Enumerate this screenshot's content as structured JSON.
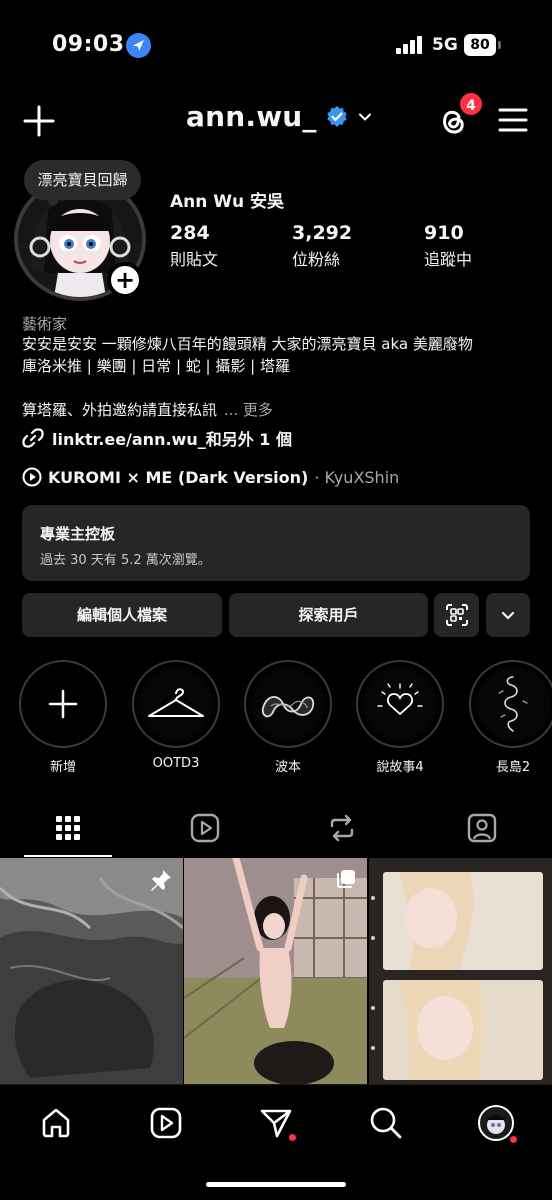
{
  "status_bar": {
    "time": "09:03",
    "network": "5G",
    "battery": "80"
  },
  "header": {
    "username": "ann.wu_",
    "threads_badge": "4"
  },
  "profile": {
    "note": "漂亮寶貝回歸",
    "display_name": "Ann Wu 安吳",
    "stats": [
      {
        "value": "284",
        "label": "則貼文"
      },
      {
        "value": "3,292",
        "label": "位粉絲"
      },
      {
        "value": "910",
        "label": "追蹤中"
      }
    ],
    "category": "藝術家",
    "bio_line1": "安安是安安 一顆修煉八百年的饅頭精 大家的漂亮寶貝 aka 美麗廢物",
    "bio_line2": "庫洛米推 | 樂團 | 日常 | 蛇 | 攝影 | 塔羅",
    "bio_line3": "算塔羅、外拍邀約請直接私訊",
    "bio_more": "... 更多",
    "link": "linktr.ee/ann.wu_和另外 1 個",
    "music_title": "KUROMI × ME (Dark Version)",
    "music_artist": "· KyuXShin"
  },
  "dashboard": {
    "title": "專業主控板",
    "subtitle": "過去 30 天有 5.2 萬次瀏覽。"
  },
  "buttons": {
    "edit_profile": "編輯個人檔案",
    "discover": "探索用戶"
  },
  "highlights": [
    {
      "label": "新增",
      "icon": "plus-icon"
    },
    {
      "label": "OOTD3",
      "icon": "hanger-icon"
    },
    {
      "label": "波本",
      "icon": "snake-coil-icon"
    },
    {
      "label": "說故事4",
      "icon": "heart-sparkle-icon"
    },
    {
      "label": "長島2",
      "icon": "snake-icon"
    }
  ],
  "tabs": [
    {
      "icon": "grid-icon",
      "active": true
    },
    {
      "icon": "reels-icon",
      "active": false
    },
    {
      "icon": "reposts-icon",
      "active": false
    },
    {
      "icon": "tagged-icon",
      "active": false
    }
  ],
  "posts": [
    {
      "icon": "pin-icon"
    },
    {
      "icon": "carousel-icon"
    },
    {
      "icon": ""
    }
  ],
  "bottom_nav": [
    {
      "icon": "home-icon"
    },
    {
      "icon": "reels-icon"
    },
    {
      "icon": "direct-icon",
      "dot": true
    },
    {
      "icon": "search-icon"
    },
    {
      "icon": "profile-avatar",
      "dot": true
    }
  ],
  "colors": {
    "background": "#000000",
    "surface": "#262628",
    "verified": "#3897f0",
    "notification": "#ff3040",
    "location": "#3d86f5"
  }
}
